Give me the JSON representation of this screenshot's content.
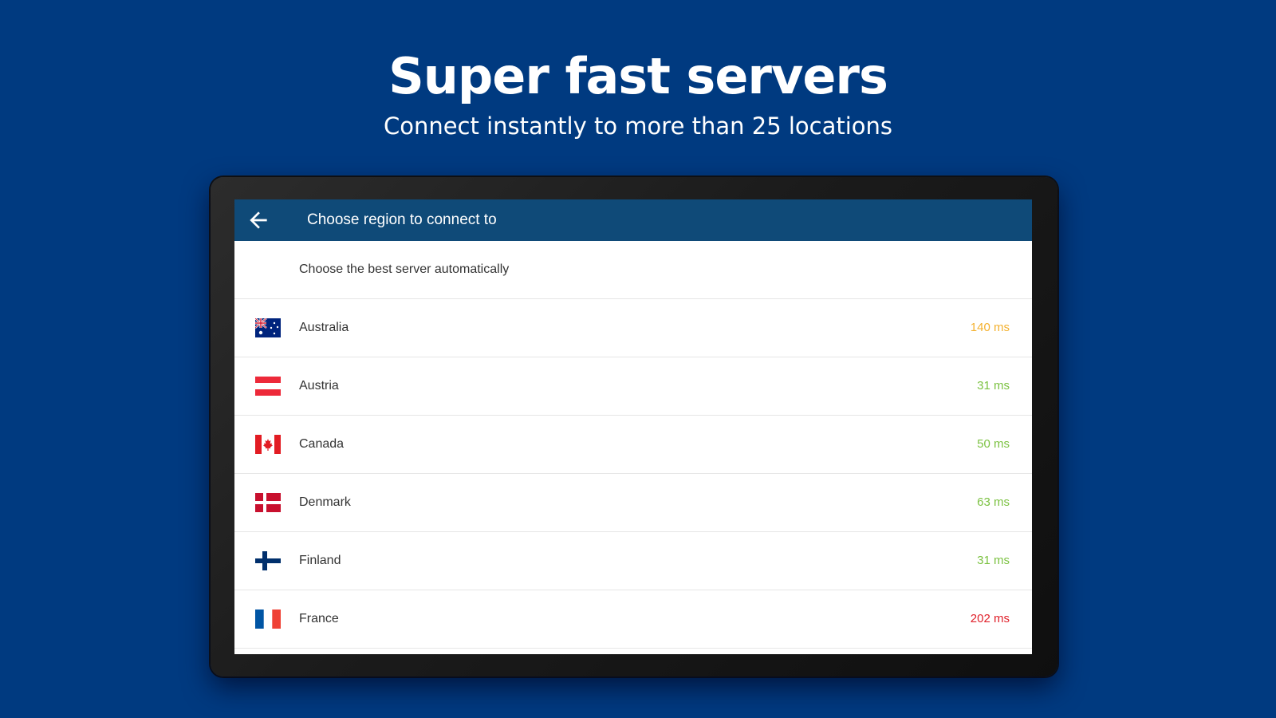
{
  "hero": {
    "title": "Super fast servers",
    "subtitle": "Connect instantly to more than 25 locations"
  },
  "app": {
    "title": "Choose region to connect to",
    "back_icon": "arrow-back-icon",
    "auto_option": "Choose the best server automatically"
  },
  "colors": {
    "background": "#003a80",
    "app_bar": "#0f4a78",
    "ping_good": "#7cc242",
    "ping_medium": "#f4b12f",
    "ping_bad": "#e0202a"
  },
  "regions": [
    {
      "country": "Australia",
      "ping": "140 ms",
      "status": "medium",
      "flag_icon": "australia-flag-icon"
    },
    {
      "country": "Austria",
      "ping": "31 ms",
      "status": "good",
      "flag_icon": "austria-flag-icon"
    },
    {
      "country": "Canada",
      "ping": "50 ms",
      "status": "good",
      "flag_icon": "canada-flag-icon"
    },
    {
      "country": "Denmark",
      "ping": "63 ms",
      "status": "good",
      "flag_icon": "denmark-flag-icon"
    },
    {
      "country": "Finland",
      "ping": "31 ms",
      "status": "good",
      "flag_icon": "finland-flag-icon"
    },
    {
      "country": "France",
      "ping": "202 ms",
      "status": "bad",
      "flag_icon": "france-flag-icon"
    }
  ]
}
